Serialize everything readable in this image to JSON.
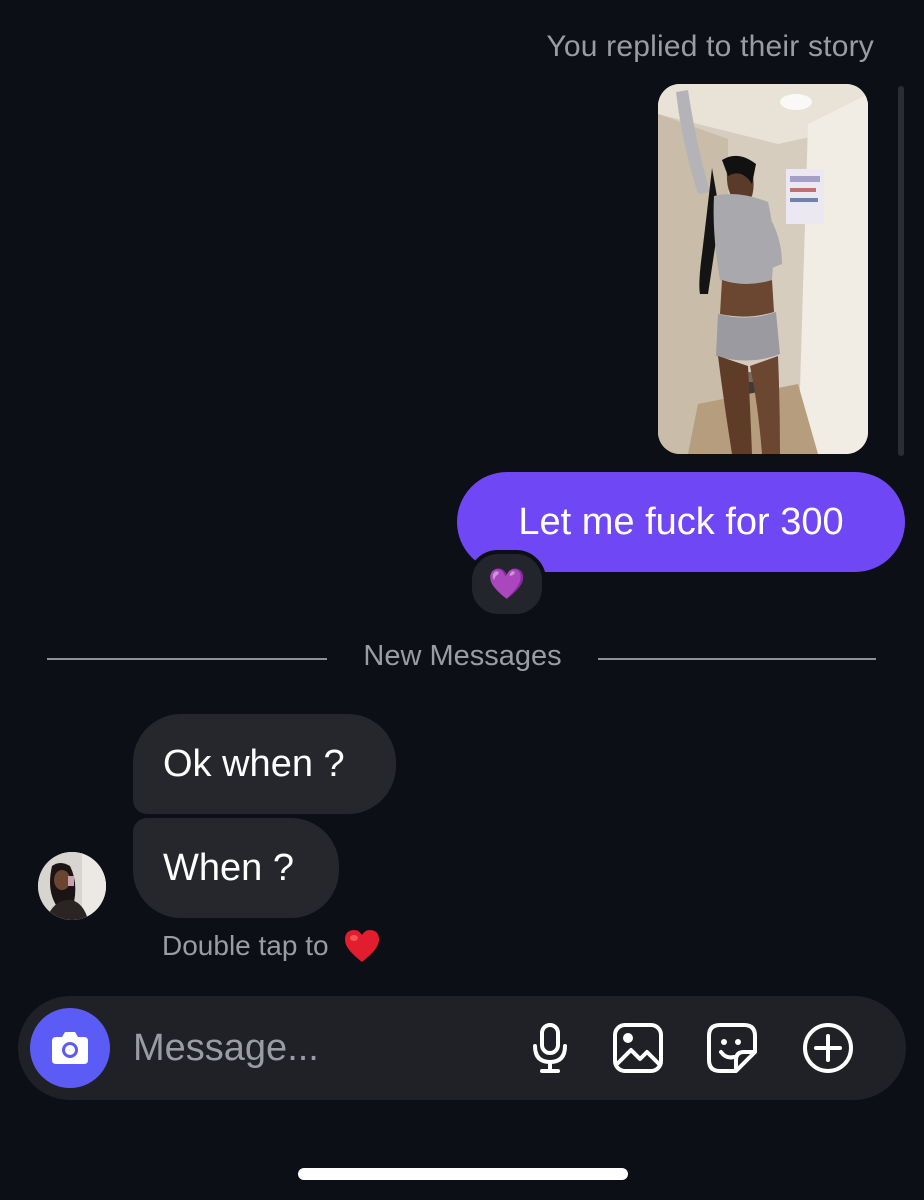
{
  "thread": {
    "story_reply_caption": "You replied to their story",
    "sent_message": {
      "text": "Let me fuck for 300",
      "reaction": "💜"
    },
    "divider_label": "New Messages",
    "received_messages": [
      {
        "text": "Ok when ?"
      },
      {
        "text": "When ?"
      }
    ],
    "double_tap_hint": "Double tap to"
  },
  "composer": {
    "placeholder": "Message...",
    "icons": [
      "camera-icon",
      "microphone-icon",
      "gallery-icon",
      "sticker-icon",
      "plus-circle-icon"
    ]
  },
  "colors": {
    "background": "#0c0f15",
    "sent_bubble": "#7047f5",
    "received_bubble": "#25272d",
    "camera_button": "#5b5cf5",
    "muted_text": "#9a9ca3"
  }
}
